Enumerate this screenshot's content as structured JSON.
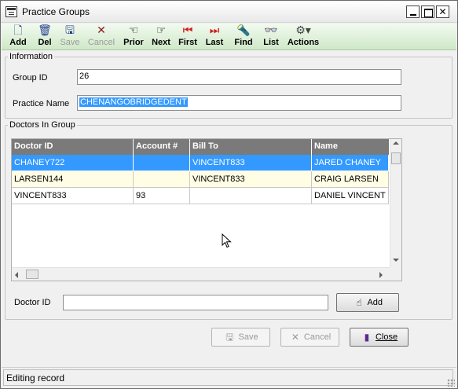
{
  "window": {
    "title": "Practice Groups",
    "icons": {
      "app": "window-app-icon",
      "minimize": "minimize-icon",
      "maximize": "maximize-icon",
      "close": "close-icon"
    },
    "close_glyph": "✕"
  },
  "toolbar": {
    "items": [
      {
        "label": "Add",
        "icon": "new-document-icon",
        "glyph": "🗋",
        "color": "#1e3a8a",
        "enabled": true
      },
      {
        "label": "Del",
        "icon": "trash-icon",
        "glyph": "🗑",
        "color": "#1e3a8a",
        "enabled": true
      },
      {
        "label": "Save",
        "icon": "floppy-disk-icon",
        "glyph": "🖫",
        "color": "#1e3a8a",
        "enabled": false
      },
      {
        "label": "Cancel",
        "icon": "cancel-x-icon",
        "glyph": "✕",
        "color": "#8b1a1a",
        "enabled": false
      },
      {
        "label": "Prior",
        "icon": "hand-point-left-icon",
        "glyph": "☜",
        "color": "#000000",
        "enabled": true
      },
      {
        "label": "Next",
        "icon": "hand-point-right-icon",
        "glyph": "☞",
        "color": "#000000",
        "enabled": true
      },
      {
        "label": "First",
        "icon": "first-record-icon",
        "glyph": "⏮",
        "color": "#d21a1a",
        "enabled": true
      },
      {
        "label": "Last",
        "icon": "last-record-icon",
        "glyph": "⏭",
        "color": "#d21a1a",
        "enabled": true
      },
      {
        "label": "Find",
        "icon": "flashlight-icon",
        "glyph": "🔦",
        "color": "#444444",
        "enabled": true
      },
      {
        "label": "List",
        "icon": "eyeglasses-icon",
        "glyph": "👓",
        "color": "#444444",
        "enabled": true
      },
      {
        "label": "Actions",
        "icon": "tools-icon",
        "glyph": "⚙▾",
        "color": "#444444",
        "enabled": true
      }
    ]
  },
  "information": {
    "group_label": "Information",
    "group_id_label": "Group ID",
    "group_id_value": "26",
    "practice_name_label": "Practice Name",
    "practice_name_value": "CHENANGOBRIDGEDENT"
  },
  "doctors": {
    "group_label": "Doctors In Group",
    "columns": [
      "Doctor ID",
      "Account #",
      "Bill To",
      "Name"
    ],
    "rows": [
      {
        "cells": [
          "CHANEY722",
          "",
          "VINCENT833",
          "JARED CHANEY"
        ],
        "selected": true
      },
      {
        "cells": [
          "LARSEN144",
          "",
          "VINCENT833",
          "CRAIG LARSEN"
        ],
        "selected": false
      },
      {
        "cells": [
          "VINCENT833",
          "93",
          "",
          "DANIEL VINCENT"
        ],
        "selected": false
      }
    ],
    "doctor_id_label": "Doctor ID",
    "doctor_id_value": "",
    "add_button_label": "Add",
    "add_icon": "hand-pointer-icon"
  },
  "footer_buttons": {
    "save": {
      "label": "Save",
      "icon": "floppy-disk-icon",
      "enabled": false
    },
    "cancel": {
      "label": "Cancel",
      "icon": "cancel-x-icon",
      "enabled": false
    },
    "close": {
      "label": "Close",
      "icon": "door-exit-icon",
      "enabled": true
    }
  },
  "status": {
    "text": "Editing record"
  },
  "colors": {
    "toolbar_gradient": "#cfe8c8",
    "selection": "#3399ff",
    "alt_row": "#fffde4",
    "grid_header": "#7a7a7a"
  }
}
